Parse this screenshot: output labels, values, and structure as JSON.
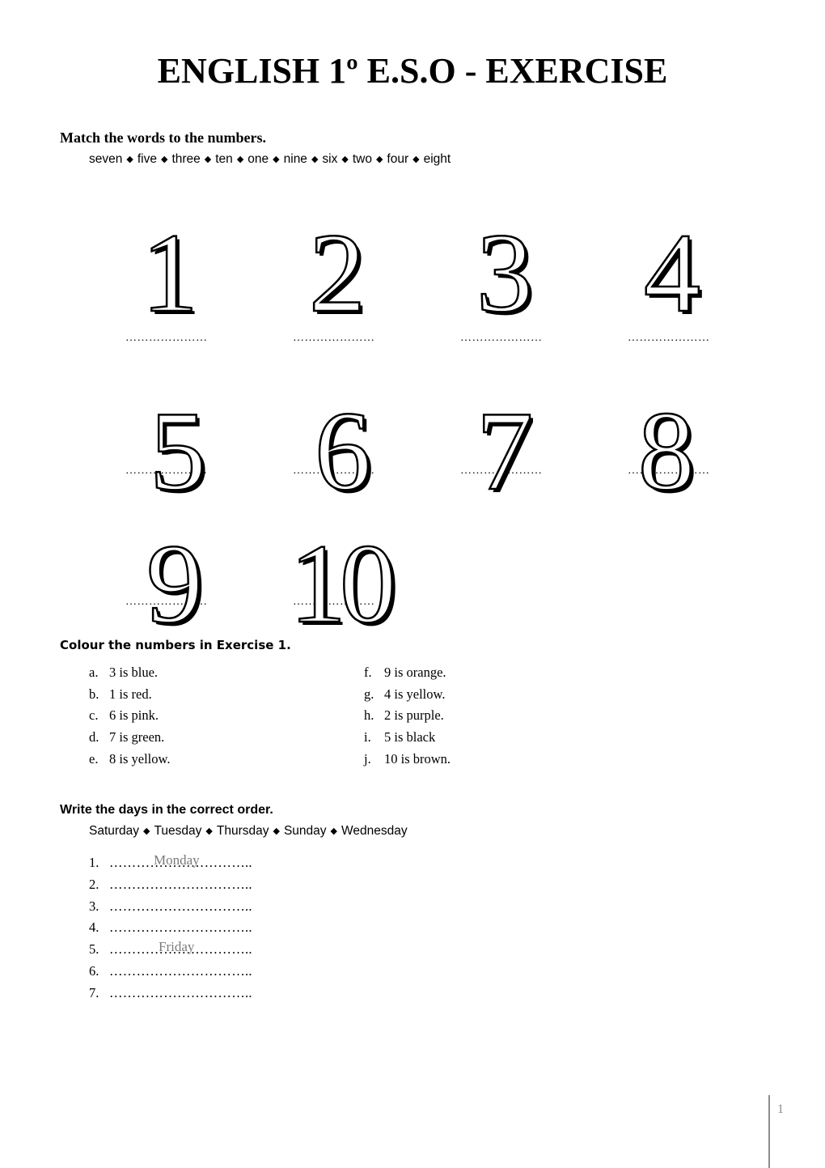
{
  "title": "ENGLISH 1º E.S.O - EXERCISE",
  "exercise1": {
    "instruction": "Match the words to the numbers.",
    "word_bank": [
      "seven",
      "five",
      "three",
      "ten",
      "one",
      "nine",
      "six",
      "two",
      "four",
      "eight"
    ],
    "separator_icon": "◆",
    "numbers": [
      "1",
      "2",
      "3",
      "4",
      "5",
      "6",
      "7",
      "8",
      "9",
      "10"
    ],
    "answer_line": "…………………"
  },
  "exercise2": {
    "instruction": "Colour the numbers in Exercise 1.",
    "items_left": [
      {
        "label": "a.",
        "text": "3 is blue."
      },
      {
        "label": "b.",
        "text": "1 is red."
      },
      {
        "label": "c.",
        "text": "6 is pink."
      },
      {
        "label": "d.",
        "text": "7 is green."
      },
      {
        "label": "e.",
        "text": "8 is yellow."
      }
    ],
    "items_right": [
      {
        "label": "f.",
        "text": "9 is orange."
      },
      {
        "label": "g.",
        "text": "4 is yellow."
      },
      {
        "label": "h.",
        "text": "2 is purple."
      },
      {
        "label": "i.",
        "text": "5 is black"
      },
      {
        "label": "j.",
        "text": "10 is brown."
      }
    ]
  },
  "exercise3": {
    "instruction": "Write the days in the correct order.",
    "word_bank": [
      "Saturday",
      "Tuesday",
      "Thursday",
      "Sunday",
      "Wednesday"
    ],
    "separator_icon": "◆",
    "answers": [
      {
        "label": "1.",
        "line": "…………………………..",
        "prefilled": "Monday"
      },
      {
        "label": "2.",
        "line": "…………………………..",
        "prefilled": ""
      },
      {
        "label": "3.",
        "line": "…………………………..",
        "prefilled": ""
      },
      {
        "label": "4.",
        "line": "…………………………..",
        "prefilled": ""
      },
      {
        "label": "5.",
        "line": "…………………………..",
        "prefilled": "Friday"
      },
      {
        "label": "6.",
        "line": "…………………………..",
        "prefilled": ""
      },
      {
        "label": "7.",
        "line": "…………………………..",
        "prefilled": ""
      }
    ]
  },
  "footer": {
    "page_number": "1"
  }
}
